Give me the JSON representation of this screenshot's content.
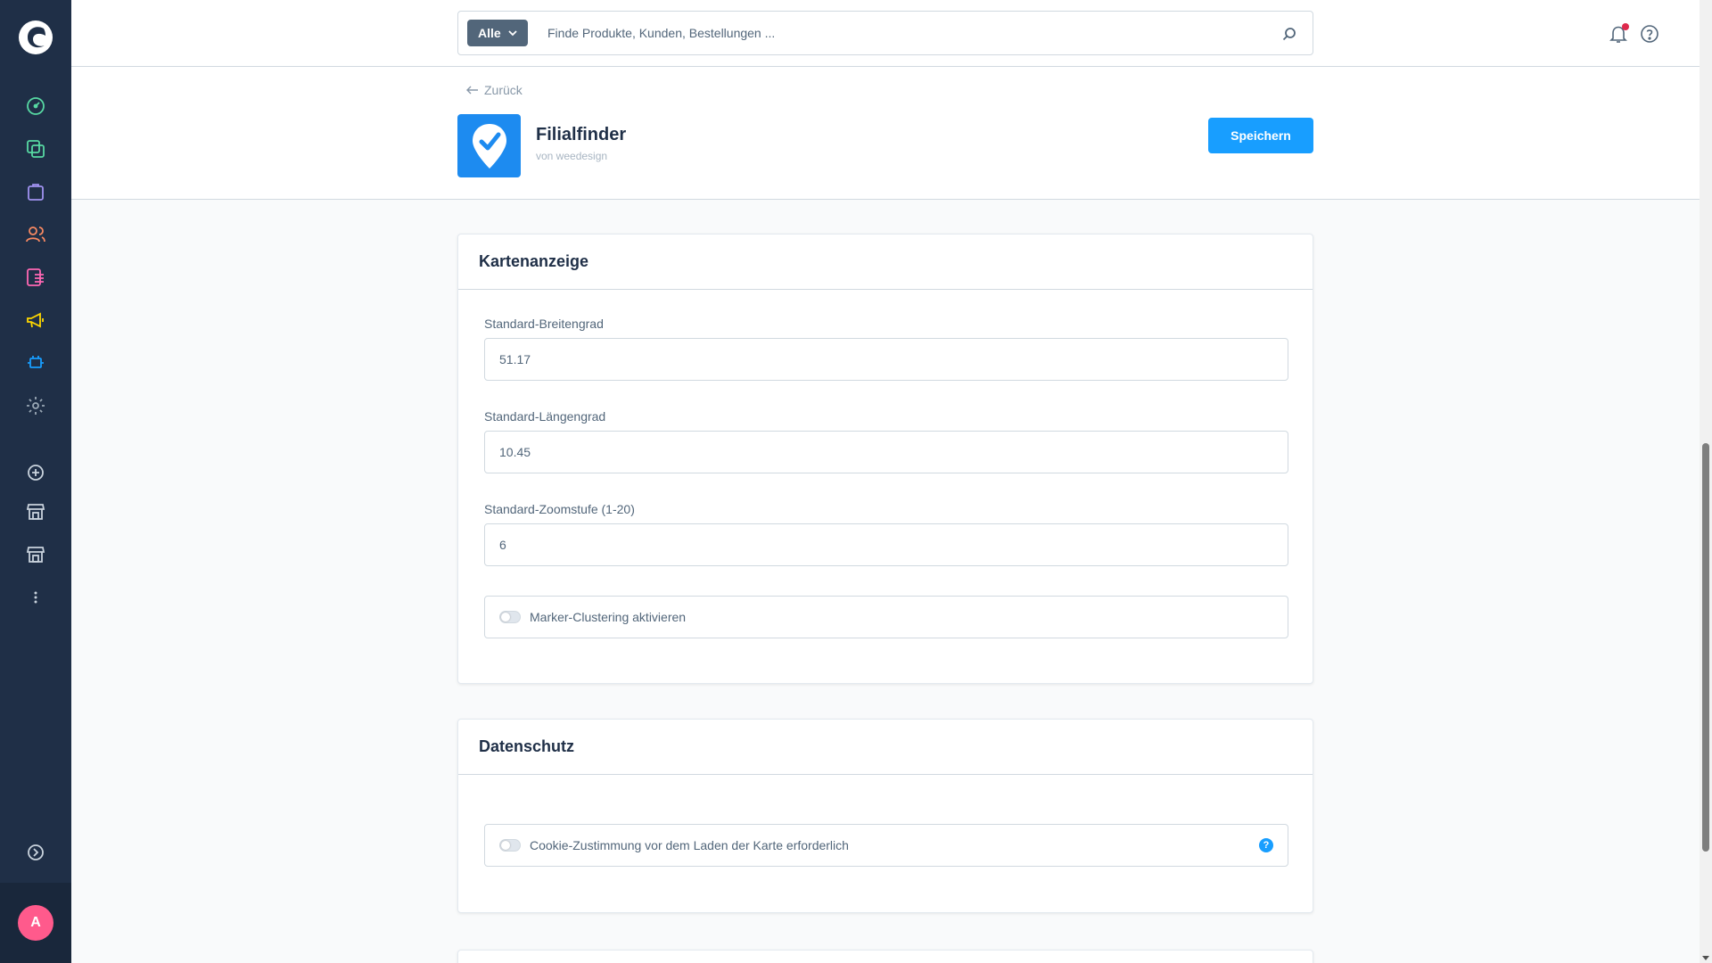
{
  "search": {
    "type_label": "Alle",
    "placeholder": "Finde Produkte, Kunden, Bestellungen ..."
  },
  "header": {
    "back_label": "Zurück",
    "app_title": "Filialfinder",
    "app_vendor": "von weedesign",
    "save_label": "Speichern"
  },
  "sidebar": {
    "avatar_initial": "A",
    "items": [
      {
        "name": "dashboard-icon",
        "color": "#57d9a3"
      },
      {
        "name": "catalogue-icon",
        "color": "#57d9a3"
      },
      {
        "name": "orders-icon",
        "color": "#a092f0"
      },
      {
        "name": "customers-icon",
        "color": "#f88962"
      },
      {
        "name": "content-icon",
        "color": "#ff68b4"
      },
      {
        "name": "marketing-icon",
        "color": "#ffd700"
      },
      {
        "name": "extensions-icon",
        "color": "#189eff"
      },
      {
        "name": "settings-icon",
        "color": "#9aa8b5"
      }
    ]
  },
  "card_map": {
    "title": "Kartenanzeige",
    "latitude_label": "Standard-Breitengrad",
    "latitude_value": "51.17",
    "longitude_label": "Standard-Längengrad",
    "longitude_value": "10.45",
    "zoom_label": "Standard-Zoomstufe (1-20)",
    "zoom_value": "6",
    "clustering_label": "Marker-Clustering aktivieren",
    "clustering_enabled": false
  },
  "card_privacy": {
    "title": "Datenschutz",
    "cookie_label": "Cookie-Zustimmung vor dem Laden der Karte erforderlich",
    "cookie_enabled": false,
    "help_glyph": "?"
  },
  "colors": {
    "sidebar": "#1f2f47",
    "primary": "#189eff",
    "app_icon": "#1d8bf0",
    "avatar": "#ff5a8c"
  }
}
